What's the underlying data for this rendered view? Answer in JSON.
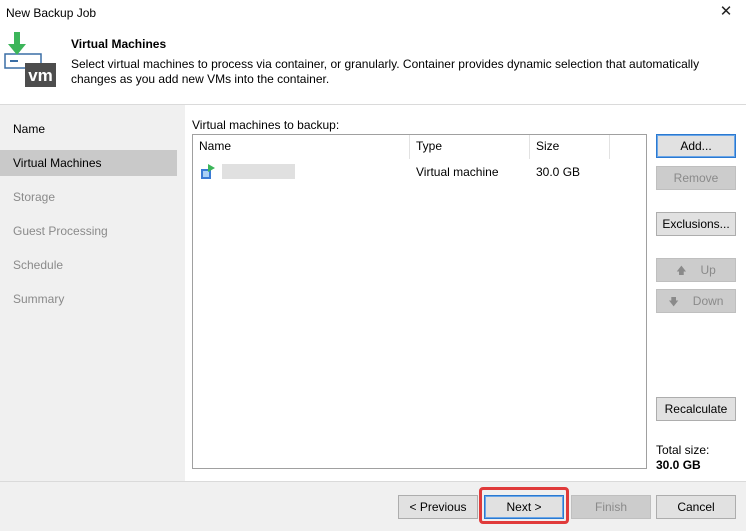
{
  "window": {
    "title": "New Backup Job",
    "close_glyph": "✕"
  },
  "header": {
    "title": "Virtual Machines",
    "description": "Select virtual machines to process via container, or granularly. Container provides dynamic selection that automatically changes as you add new VMs into the container.",
    "logo_text": "vm",
    "icon": "download-vm-icon"
  },
  "steps": [
    "Name",
    "Virtual Machines",
    "Storage",
    "Guest Processing",
    "Schedule",
    "Summary"
  ],
  "active_step": "Virtual Machines",
  "main": {
    "list_label": "Virtual machines to backup:",
    "columns": [
      "Name",
      "Type",
      "Size"
    ],
    "rows": [
      {
        "name": "",
        "type": "Virtual machine",
        "size": "30.0 GB",
        "icon": "vm-icon"
      }
    ]
  },
  "side_buttons": {
    "add": "Add...",
    "remove": "Remove",
    "exclusions": "Exclusions...",
    "up": "Up",
    "down": "Down",
    "recalculate": "Recalculate"
  },
  "total": {
    "label": "Total size:",
    "value": "30.0 GB"
  },
  "footer": {
    "previous": "< Previous",
    "next": "Next >",
    "finish": "Finish",
    "cancel": "Cancel"
  },
  "colors": {
    "highlight": "#e03a3a",
    "active_step": "#c9c9c9",
    "accent": "#2b79d0",
    "logo_green": "#3cb55a"
  }
}
